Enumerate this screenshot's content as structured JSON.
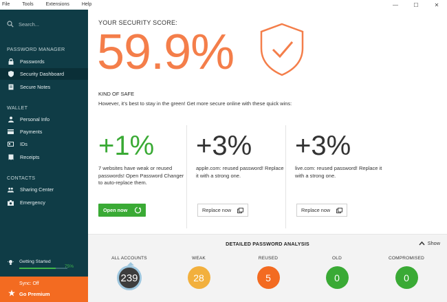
{
  "menu": [
    "File",
    "Tools",
    "Extensions",
    "Help"
  ],
  "sidebar": {
    "search_placeholder": "Search...",
    "sections": {
      "password_manager": "PASSWORD MANAGER",
      "wallet": "WALLET",
      "contacts": "CONTACTS"
    },
    "items": {
      "passwords": "Passwords",
      "security_dashboard": "Security Dashboard",
      "secure_notes": "Secure Notes",
      "personal_info": "Personal Info",
      "payments": "Payments",
      "ids": "IDs",
      "receipts": "Receipts",
      "sharing_center": "Sharing Center",
      "emergency": "Emergency"
    },
    "getting_started": {
      "label": "Getting Started",
      "percent": "75%",
      "progress": 0.75
    },
    "sync": "Sync: Off",
    "go_premium": "Go Premium"
  },
  "main": {
    "score_label": "YOUR SECURITY SCORE:",
    "score": "59.9%",
    "kind": "KIND OF SAFE",
    "advice": "However, it’s best to stay in the green! Get more secure online with these quick wins:",
    "cards": [
      {
        "gain": "+1%",
        "desc": "7 websites have weak or reused passwords! Open Password Changer to auto-replace them.",
        "button": "Open now"
      },
      {
        "gain": "+3%",
        "desc": "apple.com: reused password! Replace it with a strong one.",
        "button": "Replace now"
      },
      {
        "gain": "+3%",
        "desc": "live.com: reused password! Replace it with a strong one.",
        "button": "Replace now"
      }
    ]
  },
  "analysis": {
    "title": "DETAILED PASSWORD ANALYSIS",
    "show": "Show",
    "stats": [
      {
        "label": "ALL ACCOUNTS",
        "value": "239",
        "color": "#3d3d3d"
      },
      {
        "label": "WEAK",
        "value": "28",
        "color": "#f2b03d"
      },
      {
        "label": "REUSED",
        "value": "5",
        "color": "#f36b21"
      },
      {
        "label": "OLD",
        "value": "0",
        "color": "#3aaa35"
      },
      {
        "label": "COMPROMISED",
        "value": "0",
        "color": "#3aaa35"
      }
    ]
  },
  "colors": {
    "accent_orange": "#f47e4a",
    "sidebar_bg": "#0f3c46",
    "green": "#3aaa35",
    "premium": "#f36b21"
  }
}
